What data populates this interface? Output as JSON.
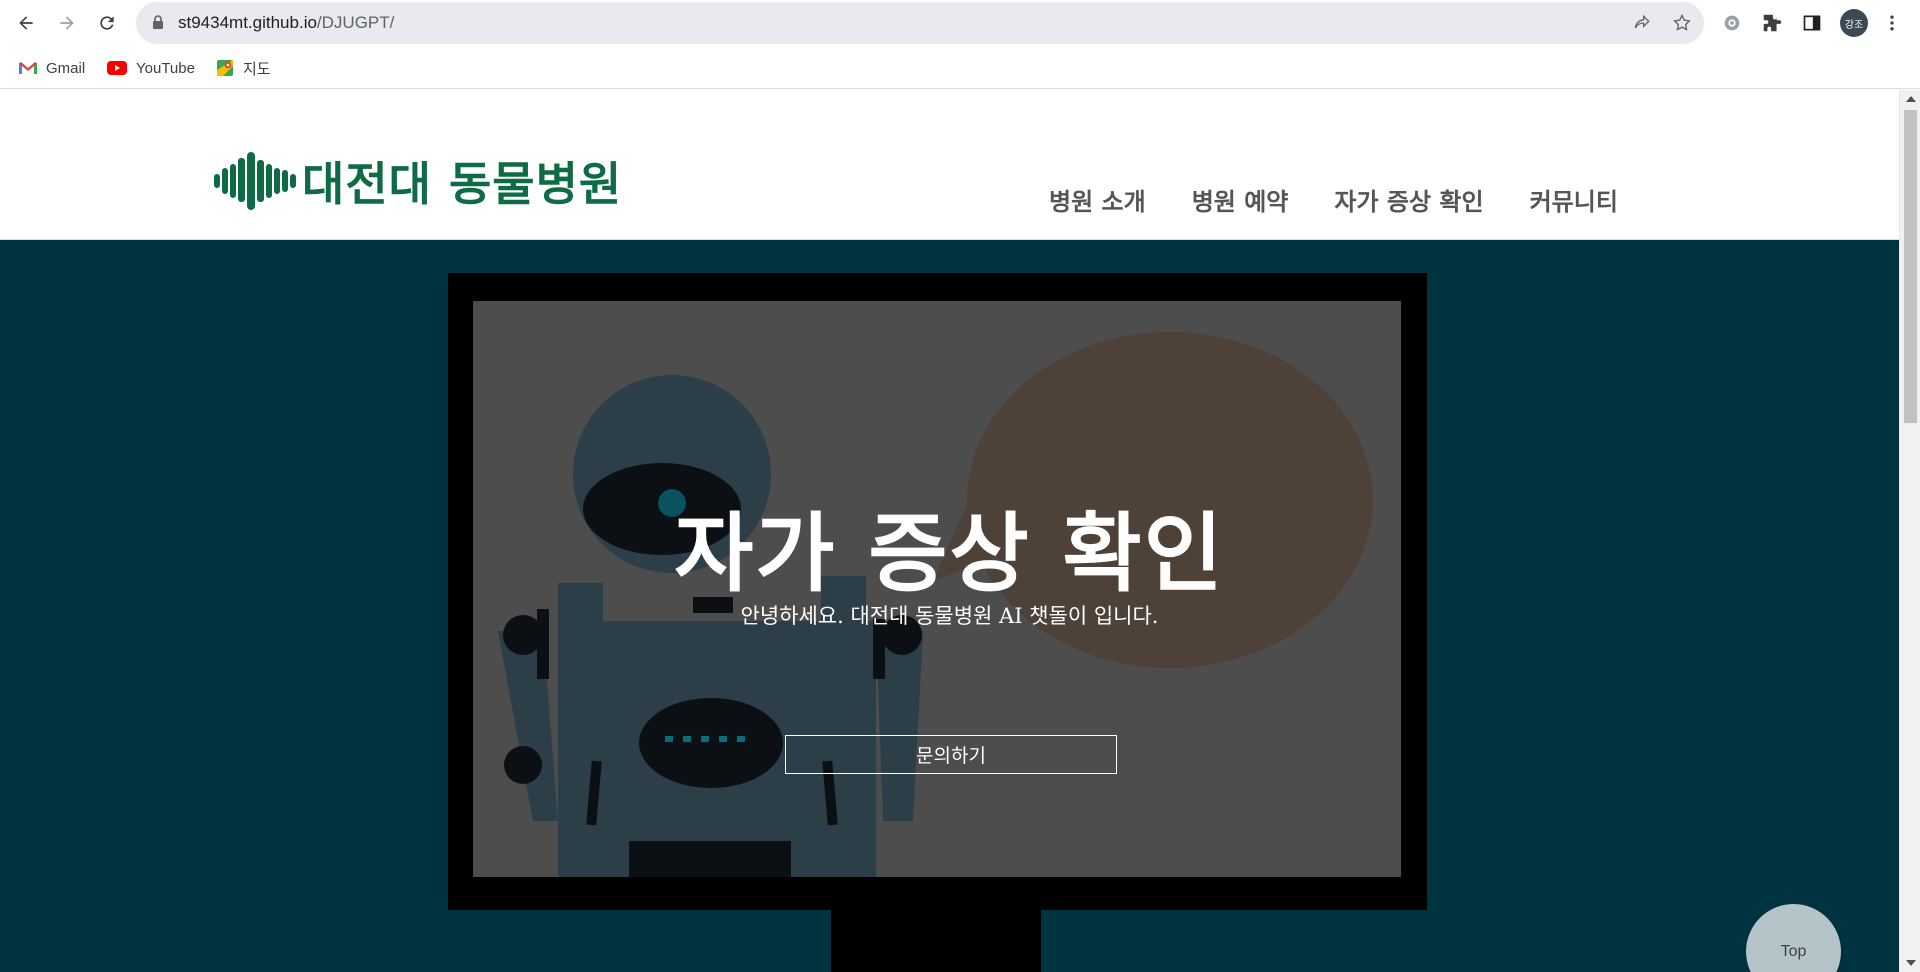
{
  "browser": {
    "url_host": "st9434mt.github.io",
    "url_path": "/DJUGPT/",
    "avatar_text": "강조",
    "bookmarks": [
      {
        "label": "Gmail",
        "icon": "gmail-icon"
      },
      {
        "label": "YouTube",
        "icon": "youtube-icon"
      },
      {
        "label": "지도",
        "icon": "maps-icon"
      }
    ]
  },
  "site": {
    "logo_text": "대전대 동물병원",
    "nav": [
      "병원 소개",
      "병원 예약",
      "자가 증상 확인",
      "커뮤니티"
    ]
  },
  "hero": {
    "title": "자가 증상 확인",
    "subtitle": "안녕하세요. 대전대 동물병원 AI 챗돌이 입니다.",
    "button_label": "문의하기",
    "top_button_label": "Top"
  },
  "colors": {
    "brand_green": "#0f6b45",
    "hero_bg": "#003340",
    "nav_text": "#555555",
    "screen_bg": "#4d4d4d",
    "speech_bubble": "#4e4138",
    "robot_body": "#2c3e48"
  }
}
